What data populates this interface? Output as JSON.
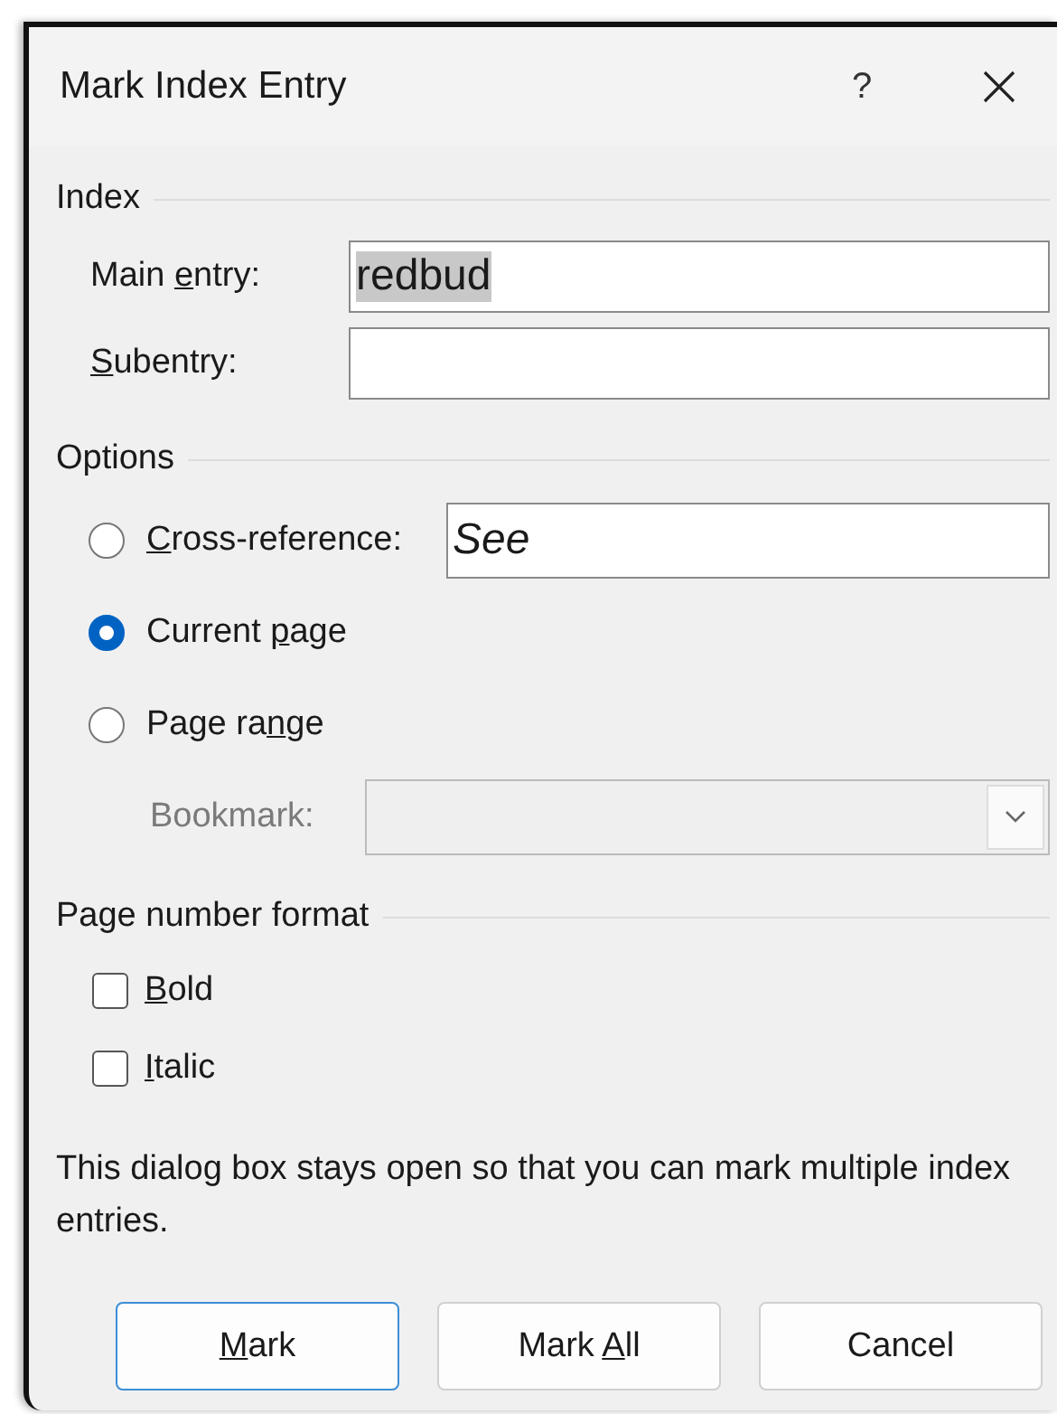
{
  "window": {
    "title": "Mark Index Entry",
    "help": "?"
  },
  "index": {
    "heading": "Index",
    "fields": [
      {
        "label": {
          "before": "Main ",
          "key": "e",
          "after": "ntry:"
        },
        "value": "redbud",
        "text_selected": true
      },
      {
        "label": {
          "key": "S",
          "after": "ubentry:"
        }
      }
    ]
  },
  "options": {
    "heading": "Options",
    "choices": [
      {
        "label": {
          "key": "C",
          "after": "ross-reference:"
        },
        "selected": false,
        "field": {
          "value": "See"
        }
      },
      {
        "label": {
          "before": "Current ",
          "key": "p",
          "after": "age"
        },
        "selected": true
      },
      {
        "label": {
          "before": "Page ra",
          "key": "n",
          "after": "ge"
        },
        "selected": false
      }
    ],
    "bookmark": {
      "label": "Bookmark:",
      "disabled": true
    }
  },
  "page_number_format": {
    "heading": "Page number format",
    "checkboxes": [
      {
        "label": {
          "key": "B",
          "after": "old"
        },
        "checked": false
      },
      {
        "label": {
          "key": "I",
          "after": "talic"
        },
        "checked": false
      }
    ]
  },
  "note": "This dialog box stays open so that you can mark multiple index entries.",
  "buttons": [
    {
      "label": {
        "key": "M",
        "after": "ark"
      },
      "default": true
    },
    {
      "label": {
        "before": "Mark ",
        "key": "A",
        "after": "ll"
      },
      "default": false
    },
    {
      "label": {
        "before": "Cancel"
      },
      "default": false
    }
  ]
}
